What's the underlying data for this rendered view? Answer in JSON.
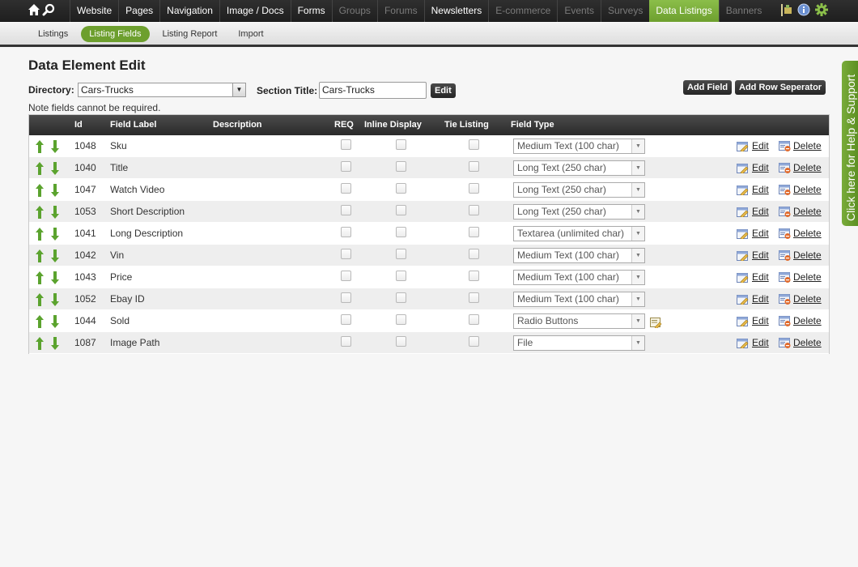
{
  "topnav": {
    "items": [
      {
        "label": "Website",
        "state": "normal"
      },
      {
        "label": "Pages",
        "state": "normal"
      },
      {
        "label": "Navigation",
        "state": "normal"
      },
      {
        "label": "Image / Docs",
        "state": "normal"
      },
      {
        "label": "Forms",
        "state": "normal"
      },
      {
        "label": "Groups",
        "state": "disabled"
      },
      {
        "label": "Forums",
        "state": "disabled"
      },
      {
        "label": "Newsletters",
        "state": "normal"
      },
      {
        "label": "E-commerce",
        "state": "disabled"
      },
      {
        "label": "Events",
        "state": "disabled"
      },
      {
        "label": "Surveys",
        "state": "disabled"
      },
      {
        "label": "Data Listings",
        "state": "active"
      },
      {
        "label": "Banners",
        "state": "disabled"
      }
    ],
    "accent": "#7aae3b"
  },
  "subnav": {
    "items": [
      {
        "label": "Listings",
        "active": false
      },
      {
        "label": "Listing Fields",
        "active": true
      },
      {
        "label": "Listing Report",
        "active": false
      },
      {
        "label": "Import",
        "active": false
      }
    ]
  },
  "page": {
    "title": "Data Element Edit",
    "directory_label": "Directory:",
    "directory_value": "Cars-Trucks",
    "section_title_label": "Section Title:",
    "section_title_value": "Cars-Trucks",
    "edit_button": "Edit",
    "add_field_button": "Add Field",
    "add_row_button": "Add Row Seperator",
    "note": "Note fields cannot be required."
  },
  "table": {
    "headers": {
      "id": "Id",
      "field_label": "Field Label",
      "description": "Description",
      "req": "REQ",
      "inline_display": "Inline Display",
      "tie_listing": "Tie Listing",
      "field_type": "Field Type"
    },
    "edit_label": "Edit",
    "delete_label": "Delete",
    "rows": [
      {
        "id": "1048",
        "label": "Sku",
        "description": "",
        "type": "Medium Text (100 char)"
      },
      {
        "id": "1040",
        "label": "Title",
        "description": "",
        "type": "Long Text (250 char)"
      },
      {
        "id": "1047",
        "label": "Watch Video",
        "description": "",
        "type": "Long Text (250 char)"
      },
      {
        "id": "1053",
        "label": "Short Description",
        "description": "",
        "type": "Long Text (250 char)"
      },
      {
        "id": "1041",
        "label": "Long Description",
        "description": "",
        "type": "Textarea (unlimited char)"
      },
      {
        "id": "1042",
        "label": "Vin",
        "description": "",
        "type": "Medium Text (100 char)"
      },
      {
        "id": "1043",
        "label": "Price",
        "description": "",
        "type": "Medium Text (100 char)"
      },
      {
        "id": "1052",
        "label": "Ebay ID",
        "description": "",
        "type": "Medium Text (100 char)"
      },
      {
        "id": "1044",
        "label": "Sold",
        "description": "",
        "type": "Radio Buttons"
      },
      {
        "id": "1087",
        "label": "Image Path",
        "description": "",
        "type": "File"
      }
    ]
  },
  "help_tab": {
    "label": "Click here for Help & Support"
  },
  "icons": {
    "home": "home-icon",
    "search": "search-icon",
    "flag": "flag-icon",
    "info": "info-icon",
    "settings": "gear-icon",
    "move_up": "arrow-up-icon",
    "move_down": "arrow-down-icon",
    "edit": "edit-icon",
    "delete": "delete-icon",
    "options": "options-edit-icon"
  }
}
